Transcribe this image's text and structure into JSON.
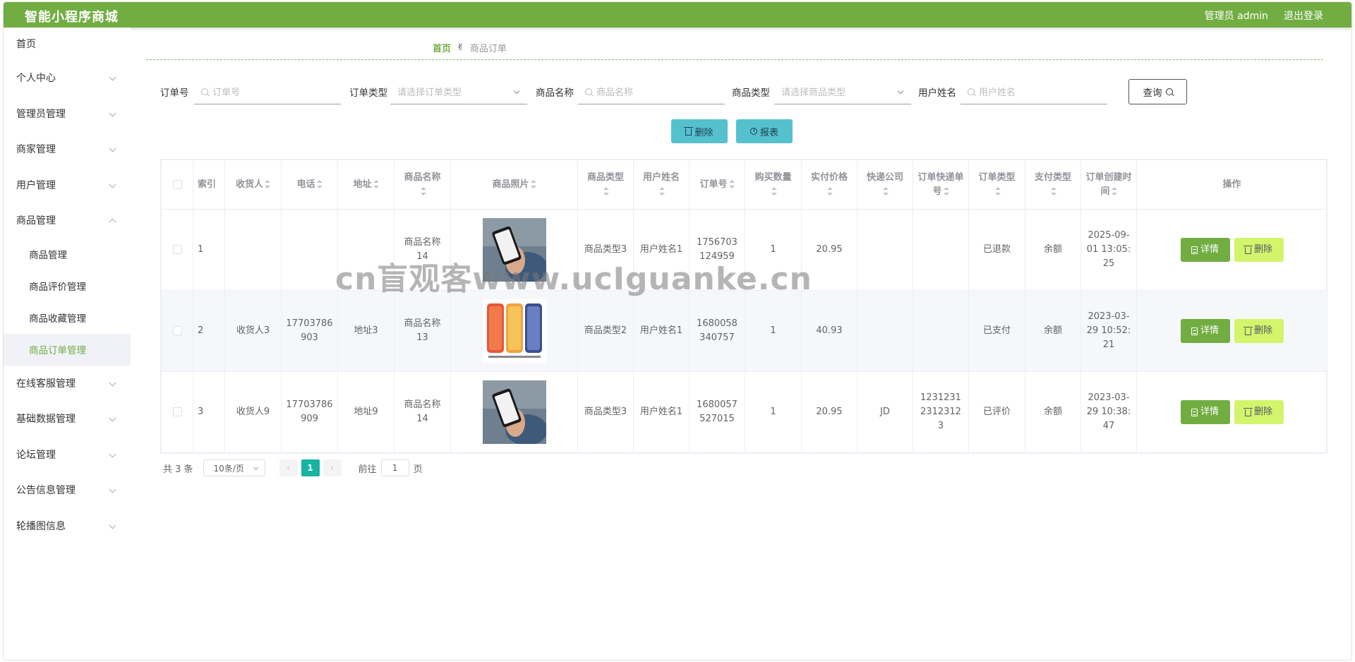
{
  "header": {
    "title": "智能小程序商城",
    "admin_label": "管理员 admin",
    "logout_label": "退出登录"
  },
  "sidebar": {
    "home": "首页",
    "items": [
      {
        "label": "个人中心"
      },
      {
        "label": "管理员管理"
      },
      {
        "label": "商家管理"
      },
      {
        "label": "用户管理"
      },
      {
        "label": "商品管理",
        "expanded": true
      }
    ],
    "sub_items": [
      "商品管理",
      "商品评价管理",
      "商品收藏管理",
      "商品订单管理"
    ],
    "active_sub": "商品订单管理",
    "items_after": [
      {
        "label": "在线客服管理"
      },
      {
        "label": "基础数据管理"
      },
      {
        "label": "论坛管理"
      },
      {
        "label": "公告信息管理"
      },
      {
        "label": "轮播图信息"
      }
    ]
  },
  "breadcrumb": {
    "home": "首页",
    "icon": "hand-icon",
    "current": "商品订单"
  },
  "search": {
    "order_no_label": "订单号",
    "order_no_placeholder": "订单号",
    "order_type_label": "订单类型",
    "order_type_placeholder": "请选择订单类型",
    "goods_name_label": "商品名称",
    "goods_name_placeholder": "商品名称",
    "goods_type_label": "商品类型",
    "goods_type_placeholder": "请选择商品类型",
    "username_label": "用户姓名",
    "username_placeholder": "用户姓名",
    "query_label": "查询"
  },
  "actions": {
    "delete_label": "删除",
    "report_label": "报表"
  },
  "table": {
    "headers": [
      "索引",
      "收货人",
      "电话",
      "地址",
      "商品名称",
      "商品照片",
      "商品类型",
      "用户姓名",
      "订单号",
      "购买数量",
      "实付价格",
      "快递公司",
      "订单快递单号",
      "订单类型",
      "支付类型",
      "订单创建时间",
      "操作"
    ],
    "rows": [
      {
        "index": "1",
        "receiver": "",
        "phone": "",
        "address": "",
        "goods_name": "商品名称14",
        "photo": "phone-in-hand",
        "goods_type": "商品类型3",
        "username": "用户姓名1",
        "order_no": "1756703124959",
        "qty": "1",
        "price": "20.95",
        "express": "",
        "express_no": "",
        "order_type": "已退款",
        "pay_type": "余额",
        "created": "2025-09-01 13:05:25"
      },
      {
        "index": "2",
        "receiver": "收货人3",
        "phone": "17703786903",
        "address": "地址3",
        "goods_name": "商品名称13",
        "photo": "three-phones",
        "goods_type": "商品类型2",
        "username": "用户姓名1",
        "order_no": "1680058340757",
        "qty": "1",
        "price": "40.93",
        "express": "",
        "express_no": "",
        "order_type": "已支付",
        "pay_type": "余额",
        "created": "2023-03-29 10:52:21"
      },
      {
        "index": "3",
        "receiver": "收货人9",
        "phone": "17703786909",
        "address": "地址9",
        "goods_name": "商品名称14",
        "photo": "phone-in-hand",
        "goods_type": "商品类型3",
        "username": "用户姓名1",
        "order_no": "1680057527015",
        "qty": "1",
        "price": "20.95",
        "express": "JD",
        "express_no": "123123123123123",
        "order_type": "已评价",
        "pay_type": "余额",
        "created": "2023-03-29 10:38:47"
      }
    ],
    "detail_label": "详情",
    "delete_label": "删除"
  },
  "pager": {
    "total": "共 3 条",
    "page_size": "10条/页",
    "prev": "‹",
    "page": "1",
    "next": "›",
    "goto_label": "前往",
    "goto_value": "1",
    "page_unit": "页"
  },
  "watermark": "cn盲观客www.ucIguanke.cn",
  "colors": {
    "primary": "#72ad42",
    "action_button": "#56c1ce",
    "delete_button": "#d2f56b",
    "current_page": "#17b3a3"
  }
}
